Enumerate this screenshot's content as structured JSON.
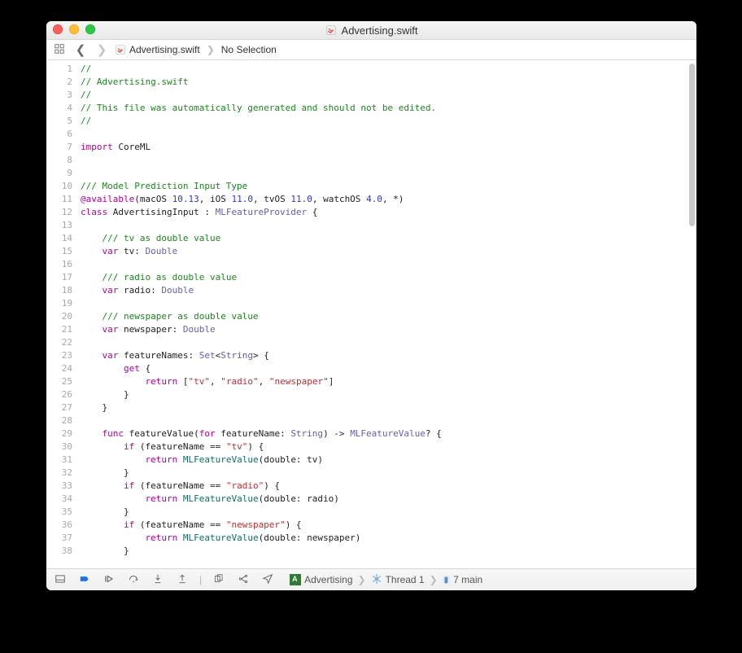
{
  "window": {
    "title": "Advertising.swift"
  },
  "jumpbar": {
    "file": "Advertising.swift",
    "selection": "No Selection"
  },
  "code_lines": [
    {
      "n": 1,
      "seg": [
        {
          "c": "cmt",
          "t": "//"
        }
      ]
    },
    {
      "n": 2,
      "seg": [
        {
          "c": "cmt",
          "t": "// Advertising.swift"
        }
      ]
    },
    {
      "n": 3,
      "seg": [
        {
          "c": "cmt",
          "t": "//"
        }
      ]
    },
    {
      "n": 4,
      "seg": [
        {
          "c": "cmt",
          "t": "// This file was automatically generated and should not be edited."
        }
      ]
    },
    {
      "n": 5,
      "seg": [
        {
          "c": "cmt",
          "t": "//"
        }
      ]
    },
    {
      "n": 6,
      "seg": [
        {
          "c": "",
          "t": ""
        }
      ]
    },
    {
      "n": 7,
      "seg": [
        {
          "c": "kw",
          "t": "import"
        },
        {
          "c": "",
          "t": " CoreML"
        }
      ]
    },
    {
      "n": 8,
      "seg": [
        {
          "c": "",
          "t": ""
        }
      ]
    },
    {
      "n": 9,
      "seg": [
        {
          "c": "",
          "t": ""
        }
      ]
    },
    {
      "n": 10,
      "seg": [
        {
          "c": "cmt",
          "t": "/// Model Prediction Input Type"
        }
      ]
    },
    {
      "n": 11,
      "seg": [
        {
          "c": "kw",
          "t": "@available"
        },
        {
          "c": "",
          "t": "(macOS "
        },
        {
          "c": "num",
          "t": "10.13"
        },
        {
          "c": "",
          "t": ", iOS "
        },
        {
          "c": "num",
          "t": "11.0"
        },
        {
          "c": "",
          "t": ", tvOS "
        },
        {
          "c": "num",
          "t": "11.0"
        },
        {
          "c": "",
          "t": ", watchOS "
        },
        {
          "c": "num",
          "t": "4.0"
        },
        {
          "c": "",
          "t": ", *)"
        }
      ]
    },
    {
      "n": 12,
      "seg": [
        {
          "c": "kw",
          "t": "class"
        },
        {
          "c": "",
          "t": " AdvertisingInput : "
        },
        {
          "c": "typ",
          "t": "MLFeatureProvider"
        },
        {
          "c": "",
          "t": " {"
        }
      ]
    },
    {
      "n": 13,
      "seg": [
        {
          "c": "",
          "t": ""
        }
      ]
    },
    {
      "n": 14,
      "seg": [
        {
          "c": "",
          "t": "    "
        },
        {
          "c": "cmt",
          "t": "/// tv as double value"
        }
      ]
    },
    {
      "n": 15,
      "seg": [
        {
          "c": "",
          "t": "    "
        },
        {
          "c": "kw",
          "t": "var"
        },
        {
          "c": "",
          "t": " tv: "
        },
        {
          "c": "typ",
          "t": "Double"
        }
      ]
    },
    {
      "n": 16,
      "seg": [
        {
          "c": "",
          "t": ""
        }
      ]
    },
    {
      "n": 17,
      "seg": [
        {
          "c": "",
          "t": "    "
        },
        {
          "c": "cmt",
          "t": "/// radio as double value"
        }
      ]
    },
    {
      "n": 18,
      "seg": [
        {
          "c": "",
          "t": "    "
        },
        {
          "c": "kw",
          "t": "var"
        },
        {
          "c": "",
          "t": " radio: "
        },
        {
          "c": "typ",
          "t": "Double"
        }
      ]
    },
    {
      "n": 19,
      "seg": [
        {
          "c": "",
          "t": ""
        }
      ]
    },
    {
      "n": 20,
      "seg": [
        {
          "c": "",
          "t": "    "
        },
        {
          "c": "cmt",
          "t": "/// newspaper as double value"
        }
      ]
    },
    {
      "n": 21,
      "seg": [
        {
          "c": "",
          "t": "    "
        },
        {
          "c": "kw",
          "t": "var"
        },
        {
          "c": "",
          "t": " newspaper: "
        },
        {
          "c": "typ",
          "t": "Double"
        }
      ]
    },
    {
      "n": 22,
      "seg": [
        {
          "c": "",
          "t": ""
        }
      ]
    },
    {
      "n": 23,
      "seg": [
        {
          "c": "",
          "t": "    "
        },
        {
          "c": "kw",
          "t": "var"
        },
        {
          "c": "",
          "t": " featureNames: "
        },
        {
          "c": "typ",
          "t": "Set"
        },
        {
          "c": "",
          "t": "<"
        },
        {
          "c": "typ",
          "t": "String"
        },
        {
          "c": "",
          "t": "> {"
        }
      ]
    },
    {
      "n": 24,
      "seg": [
        {
          "c": "",
          "t": "        "
        },
        {
          "c": "kw",
          "t": "get"
        },
        {
          "c": "",
          "t": " {"
        }
      ]
    },
    {
      "n": 25,
      "seg": [
        {
          "c": "",
          "t": "            "
        },
        {
          "c": "kw",
          "t": "return"
        },
        {
          "c": "",
          "t": " ["
        },
        {
          "c": "str",
          "t": "\"tv\""
        },
        {
          "c": "",
          "t": ", "
        },
        {
          "c": "str",
          "t": "\"radio\""
        },
        {
          "c": "",
          "t": ", "
        },
        {
          "c": "str",
          "t": "\"newspaper\""
        },
        {
          "c": "",
          "t": "]"
        }
      ]
    },
    {
      "n": 26,
      "seg": [
        {
          "c": "",
          "t": "        }"
        }
      ]
    },
    {
      "n": 27,
      "seg": [
        {
          "c": "",
          "t": "    }"
        }
      ]
    },
    {
      "n": 28,
      "seg": [
        {
          "c": "",
          "t": ""
        }
      ]
    },
    {
      "n": 29,
      "seg": [
        {
          "c": "",
          "t": "    "
        },
        {
          "c": "kw",
          "t": "func"
        },
        {
          "c": "",
          "t": " featureValue("
        },
        {
          "c": "kw",
          "t": "for"
        },
        {
          "c": "",
          "t": " featureName: "
        },
        {
          "c": "typ",
          "t": "String"
        },
        {
          "c": "",
          "t": ") -> "
        },
        {
          "c": "typ",
          "t": "MLFeatureValue"
        },
        {
          "c": "",
          "t": "? {"
        }
      ]
    },
    {
      "n": 30,
      "seg": [
        {
          "c": "",
          "t": "        "
        },
        {
          "c": "kw",
          "t": "if"
        },
        {
          "c": "",
          "t": " (featureName == "
        },
        {
          "c": "str",
          "t": "\"tv\""
        },
        {
          "c": "",
          "t": ") {"
        }
      ]
    },
    {
      "n": 31,
      "seg": [
        {
          "c": "",
          "t": "            "
        },
        {
          "c": "kw",
          "t": "return"
        },
        {
          "c": "",
          "t": " "
        },
        {
          "c": "fn",
          "t": "MLFeatureValue"
        },
        {
          "c": "",
          "t": "(double: tv)"
        }
      ]
    },
    {
      "n": 32,
      "seg": [
        {
          "c": "",
          "t": "        }"
        }
      ]
    },
    {
      "n": 33,
      "seg": [
        {
          "c": "",
          "t": "        "
        },
        {
          "c": "kw",
          "t": "if"
        },
        {
          "c": "",
          "t": " (featureName == "
        },
        {
          "c": "str",
          "t": "\"radio\""
        },
        {
          "c": "",
          "t": ") {"
        }
      ]
    },
    {
      "n": 34,
      "seg": [
        {
          "c": "",
          "t": "            "
        },
        {
          "c": "kw",
          "t": "return"
        },
        {
          "c": "",
          "t": " "
        },
        {
          "c": "fn",
          "t": "MLFeatureValue"
        },
        {
          "c": "",
          "t": "(double: radio)"
        }
      ]
    },
    {
      "n": 35,
      "seg": [
        {
          "c": "",
          "t": "        }"
        }
      ]
    },
    {
      "n": 36,
      "seg": [
        {
          "c": "",
          "t": "        "
        },
        {
          "c": "kw",
          "t": "if"
        },
        {
          "c": "",
          "t": " (featureName == "
        },
        {
          "c": "str",
          "t": "\"newspaper\""
        },
        {
          "c": "",
          "t": ") {"
        }
      ]
    },
    {
      "n": 37,
      "seg": [
        {
          "c": "",
          "t": "            "
        },
        {
          "c": "kw",
          "t": "return"
        },
        {
          "c": "",
          "t": " "
        },
        {
          "c": "fn",
          "t": "MLFeatureValue"
        },
        {
          "c": "",
          "t": "(double: newspaper)"
        }
      ]
    },
    {
      "n": 38,
      "seg": [
        {
          "c": "",
          "t": "        }"
        }
      ]
    }
  ],
  "debugbar": {
    "process_name": "Advertising",
    "thread_label": "Thread 1",
    "frame_label": "7 main"
  }
}
